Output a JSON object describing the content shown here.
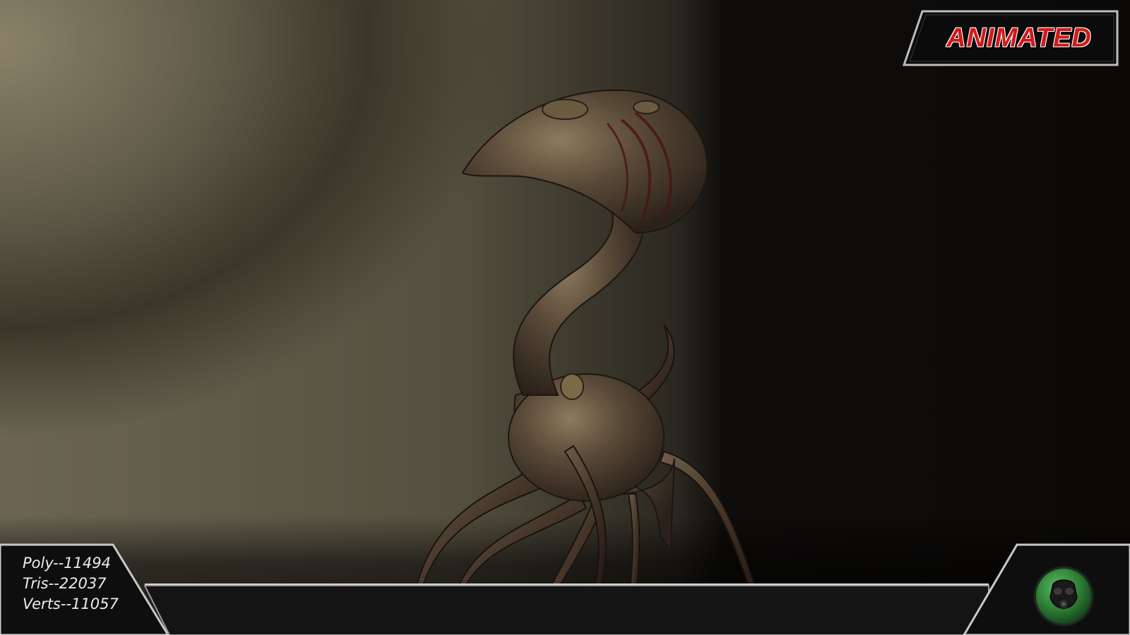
{
  "badge": {
    "label": "ANIMATED"
  },
  "stats": {
    "poly": "Poly--11494",
    "tris": "Tris--22037",
    "verts": "Verts--11057"
  },
  "logo": {
    "icon": "gas-mask-icon"
  },
  "colors": {
    "badge_text": "#d11a1a",
    "logo_green": "#2f7d35",
    "background_light": "#8a8168",
    "background_dark": "#0c0a08"
  }
}
